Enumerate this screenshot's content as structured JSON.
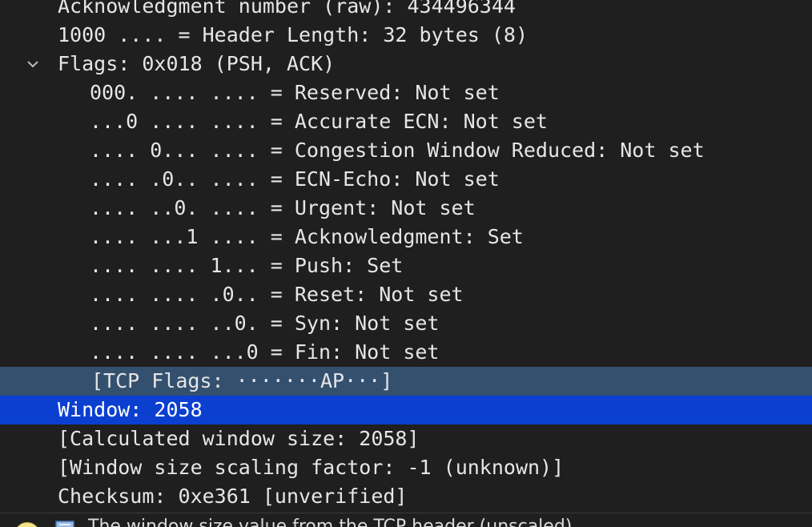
{
  "rows": [
    {
      "text": "Acknowledgment number (raw): 434496344"
    },
    {
      "text": "1000 .... = Header Length: 32 bytes (8)"
    },
    {
      "text": "Flags: 0x018 (PSH, ACK)",
      "expanded": true
    },
    {
      "text": "000. .... .... = Reserved: Not set"
    },
    {
      "text": "...0 .... .... = Accurate ECN: Not set"
    },
    {
      "text": ".... 0... .... = Congestion Window Reduced: Not set"
    },
    {
      "text": ".... .0.. .... = ECN-Echo: Not set"
    },
    {
      "text": ".... ..0. .... = Urgent: Not set"
    },
    {
      "text": ".... ...1 .... = Acknowledgment: Set"
    },
    {
      "text": ".... .... 1... = Push: Set"
    },
    {
      "text": ".... .... .0.. = Reset: Not set"
    },
    {
      "text": ".... .... ..0. = Syn: Not set"
    },
    {
      "text": ".... .... ...0 = Fin: Not set"
    },
    {
      "text": "[TCP Flags: ·······AP···]"
    },
    {
      "text": "Window: 2058"
    },
    {
      "text": "[Calculated window size: 2058]"
    },
    {
      "text": "[Window size scaling factor: -1 (unknown)]"
    },
    {
      "text": "Checksum: 0xe361 [unverified]"
    }
  ],
  "status": {
    "text": "The window size value from the TCP header (unscaled)"
  },
  "colors": {
    "background": "#1f1f1f",
    "text": "#e6e6e6",
    "selection_soft": "#34506f",
    "selection_strong": "#0b3fd0"
  }
}
